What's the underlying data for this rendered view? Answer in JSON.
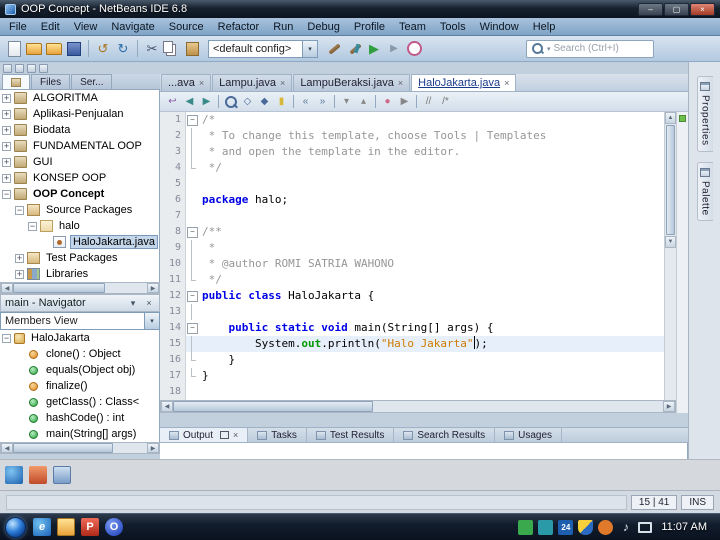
{
  "window": {
    "title": "OOP Concept - NetBeans IDE 6.8",
    "minimize": "–",
    "maximize": "▢",
    "close": "×"
  },
  "menubar": [
    "File",
    "Edit",
    "View",
    "Navigate",
    "Source",
    "Refactor",
    "Run",
    "Debug",
    "Profile",
    "Team",
    "Tools",
    "Window",
    "Help"
  ],
  "toolbar": {
    "left_icons": [
      {
        "name": "new-file-icon",
        "cls": "page"
      },
      {
        "name": "new-project-icon",
        "cls": "folder"
      },
      {
        "name": "open-project-icon",
        "cls": "folder-open"
      },
      {
        "name": "save-all-icon",
        "cls": "floppy"
      },
      {
        "name": "separator"
      },
      {
        "name": "undo-icon",
        "g": "↺",
        "c": "#a8761f"
      },
      {
        "name": "redo-icon",
        "g": "↻",
        "c": "#2c6ca8"
      },
      {
        "name": "separator"
      },
      {
        "name": "cut-icon",
        "g": "✂",
        "c": "#44506a"
      },
      {
        "name": "copy-icon",
        "cls": "copy"
      },
      {
        "name": "paste-icon",
        "cls": "paste"
      }
    ],
    "config_value": "<default config>",
    "run_icons": [
      {
        "name": "build-project-icon",
        "cls": "hammer"
      },
      {
        "name": "clean-build-project-icon",
        "cls": "hammer-broom"
      },
      {
        "name": "run-project-icon",
        "g": "▶",
        "c": "#2e9e3e"
      },
      {
        "name": "debug-project-icon",
        "g": "▶",
        "c": "#8899aa",
        "cls": "small"
      },
      {
        "name": "profile-project-icon",
        "cls": "profile"
      }
    ],
    "search_placeholder": "Search (Ctrl+I)"
  },
  "mini_toolbar": [
    {
      "name": "mini-button-1"
    },
    {
      "name": "mini-button-2"
    },
    {
      "name": "mini-button-3"
    },
    {
      "name": "mini-button-4"
    }
  ],
  "left_panel": {
    "tabs": [
      {
        "label": "",
        "name": "projects-tab",
        "active": true,
        "icon": true
      },
      {
        "label": "Files",
        "name": "files-tab"
      },
      {
        "label": "Ser...",
        "name": "services-tab"
      }
    ],
    "tree": [
      {
        "label": "ALGORITMA",
        "icon": "project",
        "indent": 0,
        "handle": "+"
      },
      {
        "label": "Aplikasi-Penjualan",
        "icon": "project",
        "indent": 0,
        "handle": "+"
      },
      {
        "label": "Biodata",
        "icon": "project",
        "indent": 0,
        "handle": "+"
      },
      {
        "label": "FUNDAMENTAL OOP",
        "icon": "project",
        "indent": 0,
        "handle": "+"
      },
      {
        "label": "GUI",
        "icon": "project",
        "indent": 0,
        "handle": "+"
      },
      {
        "label": "KONSEP OOP",
        "icon": "project",
        "indent": 0,
        "handle": "+"
      },
      {
        "label": "OOP Concept",
        "icon": "project",
        "indent": 0,
        "handle": "-",
        "bold": true
      },
      {
        "label": "Source Packages",
        "icon": "srcpkg",
        "indent": 1,
        "handle": "-"
      },
      {
        "label": "halo",
        "icon": "package",
        "indent": 2,
        "handle": "-"
      },
      {
        "label": "HaloJakarta.java",
        "icon": "javafile",
        "indent": 3,
        "selected": true
      },
      {
        "label": "Test Packages",
        "icon": "srcpkg",
        "indent": 1,
        "handle": "+"
      },
      {
        "label": "Libraries",
        "icon": "libraries",
        "indent": 1,
        "handle": "+"
      }
    ]
  },
  "navigator": {
    "title": "main - Navigator",
    "view_value": "Members View",
    "tree": [
      {
        "label": "HaloJakarta",
        "icon": "class",
        "indent": 0,
        "handle": "-"
      },
      {
        "label": "clone() : Object",
        "icon": "method-protected",
        "indent": 1
      },
      {
        "label": "equals(Object obj)",
        "icon": "method-public",
        "indent": 1
      },
      {
        "label": "finalize()",
        "icon": "method-protected",
        "indent": 1
      },
      {
        "label": "getClass() : Class<",
        "icon": "method-public",
        "indent": 1
      },
      {
        "label": "hashCode() : int",
        "icon": "method-public",
        "indent": 1
      },
      {
        "label": "main(String[] args)",
        "icon": "method-public",
        "indent": 1
      }
    ]
  },
  "editor": {
    "tabs": [
      {
        "label": "...ava",
        "name": "tab-prev-file"
      },
      {
        "label": "Lampu.java",
        "name": "tab-lampu-java"
      },
      {
        "label": "LampuBeraksi.java",
        "name": "tab-lampuberaksi-java"
      },
      {
        "label": "HaloJakarta.java",
        "name": "tab-halojakarta-java",
        "active": true
      }
    ],
    "toolbar": [
      {
        "name": "last-edit-icon",
        "g": "↩",
        "c": "#8a5aa8"
      },
      {
        "name": "back-icon",
        "g": "◀",
        "c": "#3a8a8a"
      },
      {
        "name": "forward-icon",
        "g": "▶",
        "c": "#3a8a8a"
      },
      {
        "name": "separator"
      },
      {
        "name": "find-selection-icon",
        "cls": "mag"
      },
      {
        "name": "find-next-icon",
        "g": "◇",
        "c": "#4a6a9a"
      },
      {
        "name": "find-previous-icon",
        "g": "◆",
        "c": "#4a6a9a"
      },
      {
        "name": "toggle-highlight-icon",
        "g": "▮",
        "c": "#d8b83a"
      },
      {
        "name": "separator"
      },
      {
        "name": "previous-bookmark-icon",
        "g": "«",
        "c": "#5a7a9a"
      },
      {
        "name": "next-bookmark-icon",
        "g": "»",
        "c": "#5a7a9a"
      },
      {
        "name": "separator"
      },
      {
        "name": "next-error-icon",
        "g": "▾",
        "c": "#888888"
      },
      {
        "name": "previous-error-icon",
        "g": "▴",
        "c": "#888888"
      },
      {
        "name": "separator"
      },
      {
        "name": "record-macro-icon",
        "g": "●",
        "c": "#d06a8a"
      },
      {
        "name": "run-macro-icon",
        "g": "▶",
        "c": "#888888"
      },
      {
        "name": "separator"
      },
      {
        "name": "comment-icon",
        "g": "//",
        "c": "#777777"
      },
      {
        "name": "uncomment-icon",
        "g": "/*",
        "c": "#777777"
      }
    ],
    "code": [
      {
        "n": "1",
        "fold": "box",
        "toks": [
          {
            "c": "c",
            "s": "/*"
          }
        ]
      },
      {
        "n": "2",
        "fold": "line",
        "toks": [
          {
            "c": "c",
            "s": " * To change this template, choose Tools | Templates"
          }
        ]
      },
      {
        "n": "3",
        "fold": "line",
        "toks": [
          {
            "c": "c",
            "s": " * and open the template in the editor."
          }
        ]
      },
      {
        "n": "4",
        "fold": "end",
        "toks": [
          {
            "c": "c",
            "s": " */"
          }
        ]
      },
      {
        "n": "5",
        "toks": []
      },
      {
        "n": "6",
        "toks": [
          {
            "c": "k",
            "s": "package"
          },
          {
            "c": "p",
            "s": " halo;"
          }
        ]
      },
      {
        "n": "7",
        "toks": []
      },
      {
        "n": "8",
        "fold": "box",
        "toks": [
          {
            "c": "c",
            "s": "/**"
          }
        ]
      },
      {
        "n": "9",
        "fold": "line",
        "toks": [
          {
            "c": "c",
            "s": " *"
          }
        ]
      },
      {
        "n": "10",
        "fold": "line",
        "toks": [
          {
            "c": "c",
            "s": " * @author ROMI SATRIA WAHONO"
          }
        ]
      },
      {
        "n": "11",
        "fold": "end",
        "toks": [
          {
            "c": "c",
            "s": " */"
          }
        ]
      },
      {
        "n": "12",
        "fold": "box",
        "toks": [
          {
            "c": "k",
            "s": "public"
          },
          {
            "c": "p",
            "s": " "
          },
          {
            "c": "k",
            "s": "class"
          },
          {
            "c": "p",
            "s": " HaloJakarta {"
          }
        ]
      },
      {
        "n": "13",
        "fold": "line",
        "toks": []
      },
      {
        "n": "14",
        "fold": "box",
        "toks": [
          {
            "c": "p",
            "s": "    "
          },
          {
            "c": "k",
            "s": "public"
          },
          {
            "c": "p",
            "s": " "
          },
          {
            "c": "k",
            "s": "static"
          },
          {
            "c": "p",
            "s": " "
          },
          {
            "c": "k",
            "s": "void"
          },
          {
            "c": "p",
            "s": " main(String[] args) {"
          }
        ]
      },
      {
        "n": "15",
        "fold": "line",
        "hl": true,
        "toks": [
          {
            "c": "p",
            "s": "        System."
          },
          {
            "c": "f",
            "s": "out"
          },
          {
            "c": "p",
            "s": ".println("
          },
          {
            "c": "s",
            "s": "\"Halo Jakarta\""
          },
          {
            "c": "caret",
            "s": ""
          },
          {
            "c": "p",
            "s": ");"
          }
        ]
      },
      {
        "n": "16",
        "fold": "end",
        "toks": [
          {
            "c": "p",
            "s": "    }"
          }
        ]
      },
      {
        "n": "17",
        "fold": "end",
        "toks": [
          {
            "c": "p",
            "s": "}"
          }
        ]
      },
      {
        "n": "18",
        "toks": []
      }
    ]
  },
  "bottom_panel": {
    "tabs": [
      {
        "label": "Output",
        "name": "output-tab",
        "active": true,
        "controls": true
      },
      {
        "label": "Tasks",
        "name": "tasks-tab"
      },
      {
        "label": "Test Results",
        "name": "test-results-tab"
      },
      {
        "label": "Search Results",
        "name": "search-results-tab"
      },
      {
        "label": "Usages",
        "name": "usages-tab"
      }
    ]
  },
  "right_panel": {
    "tabs": [
      {
        "label": "Properties",
        "name": "properties-tab"
      },
      {
        "label": "Palette",
        "name": "palette-tab"
      }
    ]
  },
  "status": {
    "caret_position": "15 | 41",
    "mode": "INS"
  },
  "shortcuts": [
    {
      "name": "desktop-shortcut-1",
      "cls": "sc-blue"
    },
    {
      "name": "desktop-shortcut-2",
      "cls": "sc-red"
    },
    {
      "name": "desktop-shortcut-3",
      "cls": "sc-nb"
    }
  ],
  "taskbar": {
    "quick_launch": [
      {
        "name": "internet-browser-icon",
        "cls": "ql-ie",
        "g": "e"
      },
      {
        "name": "folder-icon",
        "cls": "ql-folder"
      },
      {
        "name": "pdf-reader-icon",
        "cls": "ql-pdf",
        "g": "P"
      },
      {
        "name": "opera-browser-icon",
        "cls": "ql-opera",
        "g": "O"
      }
    ],
    "tray": [
      {
        "name": "tray-antivirus-icon",
        "cls": "tr-green"
      },
      {
        "name": "tray-messenger-icon",
        "cls": "tr-teal"
      },
      {
        "name": "tray-date-icon",
        "cls": "tr-blue",
        "g": "24"
      },
      {
        "name": "tray-security-shield-icon",
        "cls": "tr-shield"
      },
      {
        "name": "tray-update-icon",
        "cls": "tr-orange"
      },
      {
        "name": "tray-volume-icon",
        "cls": "tr-vol",
        "g": "♪"
      },
      {
        "name": "tray-network-icon",
        "cls": "tr-net"
      }
    ],
    "clock": "11:07 AM"
  },
  "colors": {
    "keyword": "#0000e6",
    "comment": "#969696",
    "string": "#ce7b00",
    "field": "#009900",
    "selection_bg": "#c4d6ea",
    "current_line_bg": "#e7effa",
    "error_stripe_ok": "#6cbf4a"
  }
}
